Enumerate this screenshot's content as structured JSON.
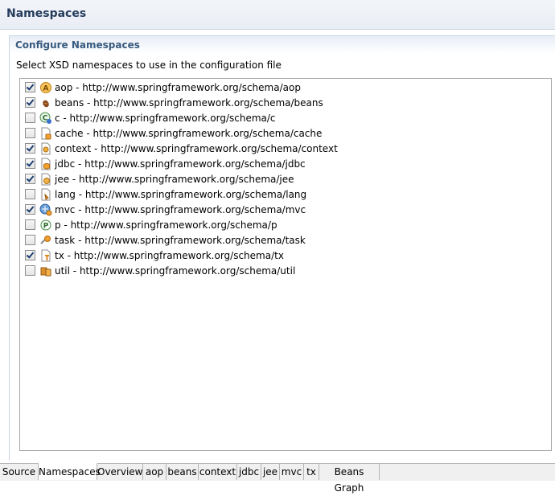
{
  "header": {
    "title": "Namespaces"
  },
  "section": {
    "title": "Configure Namespaces",
    "description": "Select XSD namespaces to use in the configuration file"
  },
  "namespaces": [
    {
      "label": "aop - http://www.springframework.org/schema/aop",
      "checked": true,
      "icon": "aop-icon"
    },
    {
      "label": "beans - http://www.springframework.org/schema/beans",
      "checked": true,
      "icon": "bean-icon"
    },
    {
      "label": "c - http://www.springframework.org/schema/c",
      "checked": false,
      "icon": "c-namespace-icon"
    },
    {
      "label": "cache - http://www.springframework.org/schema/cache",
      "checked": false,
      "icon": "cache-icon"
    },
    {
      "label": "context - http://www.springframework.org/schema/context",
      "checked": true,
      "icon": "context-icon"
    },
    {
      "label": "jdbc - http://www.springframework.org/schema/jdbc",
      "checked": true,
      "icon": "jdbc-icon"
    },
    {
      "label": "jee - http://www.springframework.org/schema/jee",
      "checked": true,
      "icon": "jee-icon"
    },
    {
      "label": "lang - http://www.springframework.org/schema/lang",
      "checked": false,
      "icon": "lang-icon"
    },
    {
      "label": "mvc - http://www.springframework.org/schema/mvc",
      "checked": true,
      "icon": "mvc-icon"
    },
    {
      "label": "p - http://www.springframework.org/schema/p",
      "checked": false,
      "icon": "p-namespace-icon"
    },
    {
      "label": "task - http://www.springframework.org/schema/task",
      "checked": false,
      "icon": "task-icon"
    },
    {
      "label": "tx - http://www.springframework.org/schema/tx",
      "checked": true,
      "icon": "tx-icon"
    },
    {
      "label": "util - http://www.springframework.org/schema/util",
      "checked": false,
      "icon": "util-icon"
    }
  ],
  "tabs": [
    {
      "label": "Source",
      "active": false
    },
    {
      "label": "Namespaces",
      "active": true
    },
    {
      "label": "Overview",
      "active": false
    },
    {
      "label": "aop",
      "active": false
    },
    {
      "label": "beans",
      "active": false
    },
    {
      "label": "context",
      "active": false
    },
    {
      "label": "jdbc",
      "active": false
    },
    {
      "label": "jee",
      "active": false
    },
    {
      "label": "mvc",
      "active": false
    },
    {
      "label": "tx",
      "active": false
    },
    {
      "label": "Beans Graph",
      "active": false
    }
  ]
}
